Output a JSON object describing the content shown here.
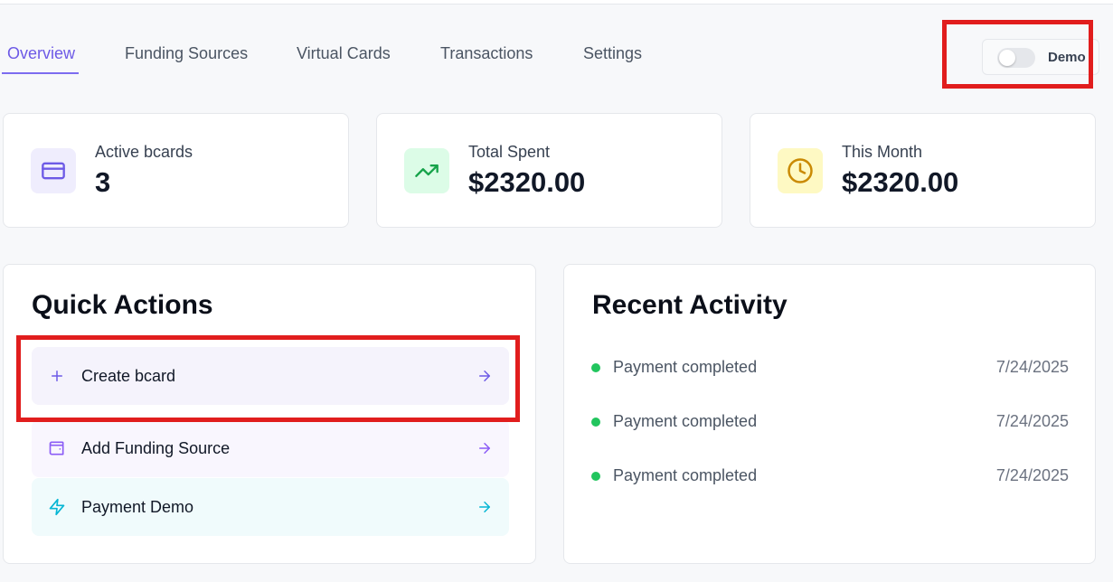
{
  "tabs": [
    {
      "label": "Overview",
      "active": true
    },
    {
      "label": "Funding Sources",
      "active": false
    },
    {
      "label": "Virtual Cards",
      "active": false
    },
    {
      "label": "Transactions",
      "active": false
    },
    {
      "label": "Settings",
      "active": false
    }
  ],
  "demo_toggle": {
    "label": "Demo",
    "on": false
  },
  "stats": [
    {
      "label": "Active bcards",
      "value": "3",
      "icon": "credit-card-icon",
      "color": "#6d5ae6",
      "bg": "#efedfd"
    },
    {
      "label": "Total Spent",
      "value": "$2320.00",
      "icon": "trending-up-icon",
      "color": "#16a34a",
      "bg": "#dcfce7"
    },
    {
      "label": "This Month",
      "value": "$2320.00",
      "icon": "clock-icon",
      "color": "#ca8a04",
      "bg": "#fef9c3"
    }
  ],
  "quick_actions": {
    "title": "Quick Actions",
    "items": [
      {
        "label": "Create bcard",
        "icon": "plus-icon",
        "color": "#6d5ae6",
        "bg": "#f5f3fc"
      },
      {
        "label": "Add Funding Source",
        "icon": "wallet-icon",
        "color": "#8b5cf6",
        "bg": "#f9f6fe"
      },
      {
        "label": "Payment Demo",
        "icon": "lightning-icon",
        "color": "#06b6d4",
        "bg": "#f0fbfc"
      }
    ]
  },
  "recent_activity": {
    "title": "Recent Activity",
    "items": [
      {
        "text": "Payment completed",
        "date": "7/24/2025"
      },
      {
        "text": "Payment completed",
        "date": "7/24/2025"
      },
      {
        "text": "Payment completed",
        "date": "7/24/2025"
      }
    ]
  },
  "colors": {
    "accent": "#6d5ae6",
    "highlight": "#e11d1d",
    "status_dot": "#22c55e"
  }
}
